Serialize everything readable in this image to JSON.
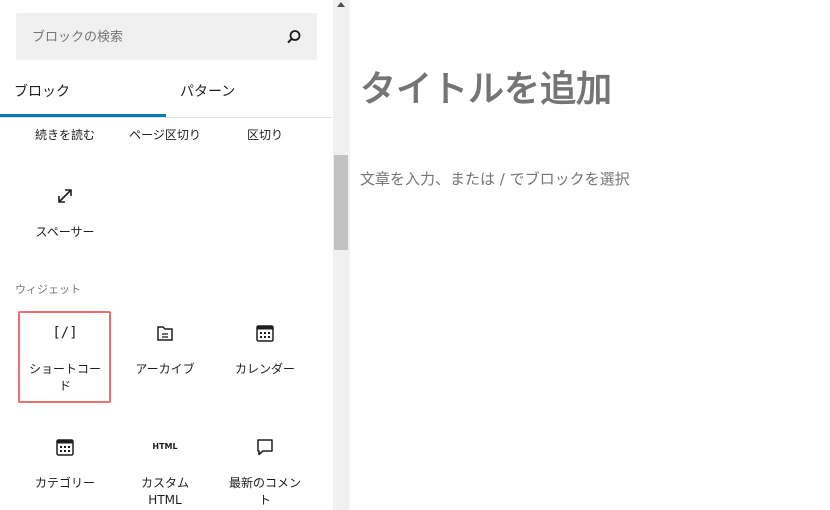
{
  "search": {
    "placeholder": "ブロックの検索"
  },
  "tabs": [
    {
      "label": "ブロック"
    },
    {
      "label": "パターン"
    }
  ],
  "blocks_top": [
    {
      "label": "続きを読む"
    },
    {
      "label": "ページ区切り"
    },
    {
      "label": "区切り"
    }
  ],
  "spacer": {
    "label": "スペーサー",
    "icon": "resize-arrow-icon"
  },
  "widgets": {
    "title": "ウィジェット",
    "items": [
      {
        "label": "ショートコード",
        "icon": "shortcode-icon",
        "icon_text": "[/]"
      },
      {
        "label": "アーカイブ",
        "icon": "folder-icon"
      },
      {
        "label": "カレンダー",
        "icon": "calendar-icon"
      },
      {
        "label": "カテゴリー",
        "icon": "category-icon"
      },
      {
        "label": "カスタム HTML",
        "icon": "html-icon",
        "icon_text": "HTML"
      },
      {
        "label": "最新のコメント",
        "icon": "comment-icon"
      }
    ]
  },
  "editor": {
    "title_placeholder": "タイトルを追加",
    "body_placeholder": "文章を入力、または / でブロックを選択"
  },
  "colors": {
    "accent": "#007cba",
    "highlight": "#e87070"
  }
}
